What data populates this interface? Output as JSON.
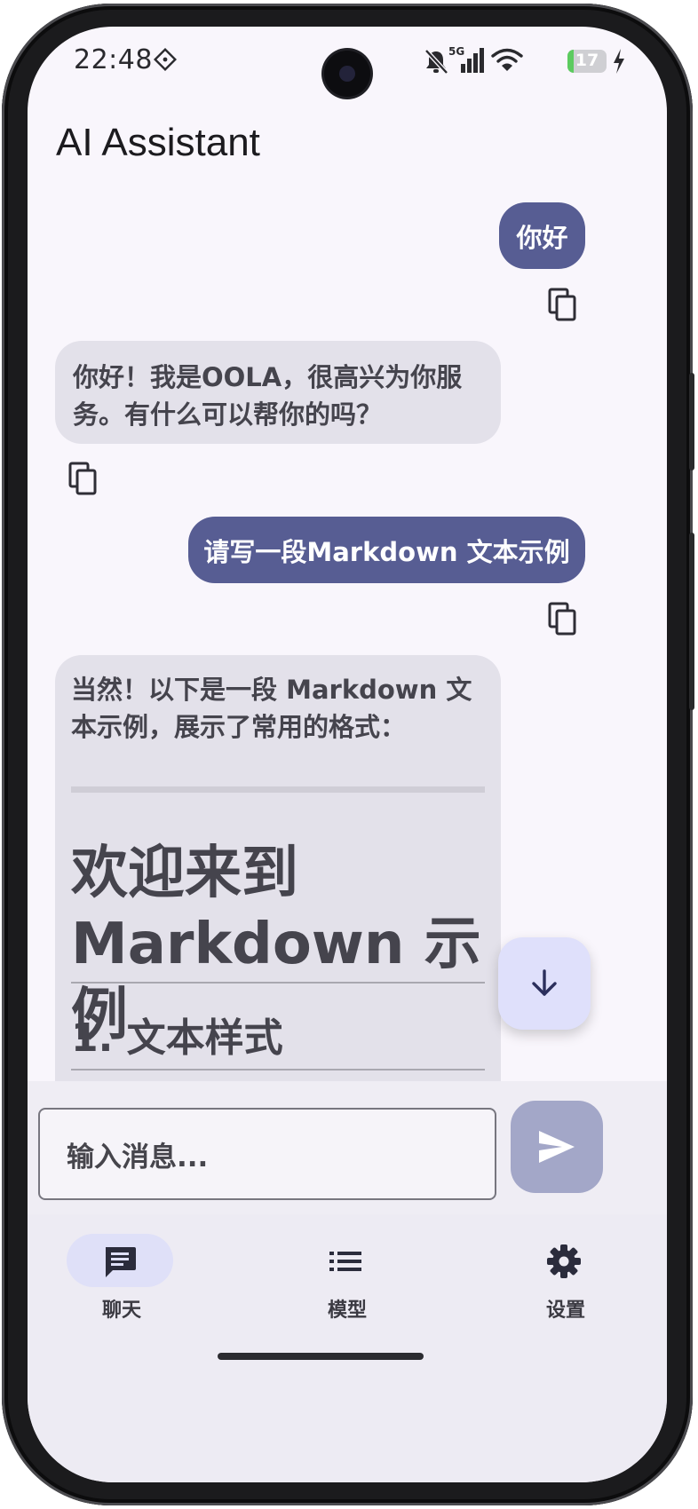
{
  "status_bar": {
    "time": "22:48",
    "battery_level": "17",
    "icons": [
      "diamond-icon",
      "bell-off-icon",
      "cellular-5g-icon",
      "wifi-icon",
      "battery-icon",
      "charging-bolt-icon"
    ]
  },
  "app_bar": {
    "title": "AI Assistant"
  },
  "messages": [
    {
      "role": "user",
      "text": "你好"
    },
    {
      "role": "assistant",
      "text": "你好！我是OOLA，很高兴为你服务。有什么可以帮你的吗？"
    },
    {
      "role": "user",
      "text": "请写一段Markdown 文本示例"
    },
    {
      "role": "assistant",
      "text": "当然！以下是一段 Markdown 文本示例，展示了常用的格式：",
      "heading1": "欢迎来到 Markdown 示例",
      "heading2": "1. 文本样式"
    }
  ],
  "composer": {
    "placeholder": "输入消息..."
  },
  "nav": {
    "items": [
      {
        "label": "聊天",
        "icon": "chat-icon",
        "active": true
      },
      {
        "label": "模型",
        "icon": "list-icon",
        "active": false
      },
      {
        "label": "设置",
        "icon": "gear-icon",
        "active": false
      }
    ]
  },
  "colors": {
    "user_bubble": "#575d93",
    "assistant_bubble": "#e3e1ea",
    "accent_container": "#dfe0fb",
    "send_button_disabled": "#a3a7c8",
    "background": "#f9f6fc"
  }
}
